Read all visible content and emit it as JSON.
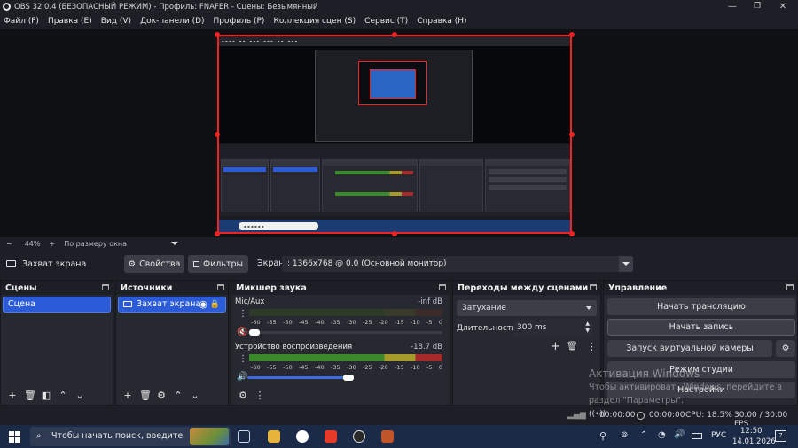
{
  "window": {
    "title": "OBS 32.0.4 (БЕЗОПАСНЫЙ РЕЖИМ) - Профиль: FNAFER - Сцены: Безымянный"
  },
  "menu": [
    "Файл (F)",
    "Правка (E)",
    "Вид (V)",
    "Док-панели (D)",
    "Профиль (P)",
    "Коллекция сцен (S)",
    "Сервис (T)",
    "Справка (H)"
  ],
  "zoom": {
    "minus": "−",
    "level": "44%",
    "plus": "+",
    "fit": "По размеру окна"
  },
  "source_bar": {
    "source_name": "Захват экрана",
    "properties": "Свойства",
    "filters": "Фильтры",
    "screen_label": "Экран",
    "screen_value": ": 1366x768 @ 0,0 (Основной монитор)"
  },
  "scenes": {
    "title": "Сцены",
    "items": [
      "Сцена"
    ]
  },
  "sources": {
    "title": "Источники",
    "items": [
      "Захват экрана"
    ]
  },
  "mixer": {
    "title": "Микшер звука",
    "channels": [
      {
        "name": "Mic/Aux",
        "db": "-inf dB",
        "volume_fraction": 0.0,
        "muted": true
      },
      {
        "name": "Устройство воспроизведения",
        "db": "-18.7 dB",
        "volume_fraction": 0.95,
        "muted": false
      }
    ],
    "ticks": [
      "-60",
      "-55",
      "-50",
      "-45",
      "-40",
      "-35",
      "-30",
      "-25",
      "-20",
      "-15",
      "-10",
      "-5",
      "0"
    ]
  },
  "transitions": {
    "title": "Переходы между сценами",
    "selected": "Затухание",
    "duration_label": "Длительность",
    "duration_value": "300 ms"
  },
  "controls": {
    "title": "Управление",
    "start_stream": "Начать трансляцию",
    "start_record": "Начать запись",
    "virtual_cam": "Запуск виртуальной камеры",
    "studio_mode": "Режим студии",
    "settings": "Настройки"
  },
  "status": {
    "stream_time": "00:00:00",
    "record_time": "00:00:00",
    "cpu": "CPU: 18.5%",
    "fps": "30.00 / 30.00 FPS"
  },
  "watermark": {
    "title": "Активация Windows",
    "line1": "Чтобы активировать Windows, перейдите в",
    "line2": "раздел \"Параметры\"."
  },
  "taskbar": {
    "search_placeholder": "Чтобы начать поиск, введите",
    "lang": "РУС",
    "time": "12:50",
    "date": "14.01.2026",
    "notify_count": "7"
  },
  "colors": {
    "accent": "#2b5bd7",
    "meter_green": "#3a8a2a",
    "meter_yellow": "#a69a2a",
    "meter_red": "#a62a2a",
    "preview_border": "#ee2222"
  }
}
